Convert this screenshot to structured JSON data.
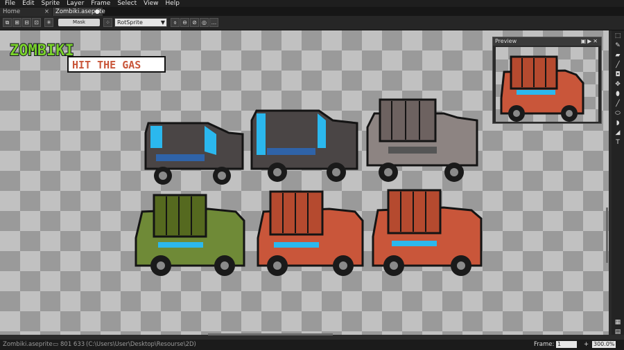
{
  "menu": [
    "File",
    "Edit",
    "Sprite",
    "Layer",
    "Frame",
    "Select",
    "View",
    "Help"
  ],
  "tabs": {
    "home": "Home",
    "file": "Zombiki.aseprite",
    "close": "×",
    "modified": "●"
  },
  "context_bar": {
    "mask_label": "Mask",
    "rotation_algorithm": "RotSprite",
    "more": "..."
  },
  "logo": {
    "line1": "ZOMBIKI",
    "line2": "HIT THE GAS"
  },
  "preview": {
    "title": "Preview"
  },
  "status": {
    "filename": "Zombiki.aseprite",
    "dimensions": "801 633",
    "path": "(C:\\Users\\User\\Desktop\\Resourse\\2D)",
    "frame_label": "Frame:",
    "frame_value": "1",
    "zoom_value": "300.0%"
  },
  "colors": {
    "accent_green": "#7ad12b",
    "cab_blue": "#2bb8ee",
    "red_car": "#c9563a",
    "green_car": "#6f8a37",
    "dark_car": "#4a4545",
    "grey_car": "#8d8482"
  }
}
